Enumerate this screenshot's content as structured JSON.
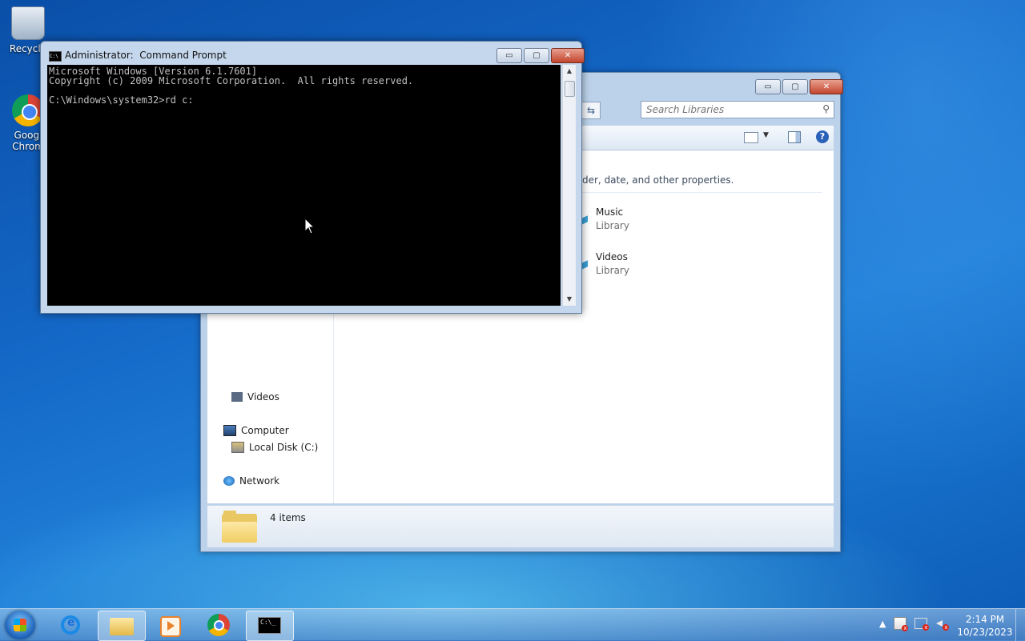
{
  "desktop": {
    "icons": [
      {
        "label": "Recycle",
        "icon": "recycle-bin-icon"
      },
      {
        "label": "Googl\nChrom",
        "icon": "chrome-icon"
      }
    ]
  },
  "explorer": {
    "search_placeholder": "Search Libraries",
    "description": "der, date, and other properties.",
    "nav": {
      "videos": "Videos",
      "computer": "Computer",
      "local_disk": "Local Disk (C:)",
      "network": "Network"
    },
    "libraries": [
      {
        "name": "Music",
        "type": "Library"
      },
      {
        "name": "Videos",
        "type": "Library"
      }
    ],
    "status": "4 items",
    "buttons": {
      "minimize": "▭",
      "maximize": "▢",
      "close": "✕"
    }
  },
  "cmd": {
    "title": "Administrator:  Command Prompt",
    "icon_text": "C:\\",
    "output": "Microsoft Windows [Version 6.1.7601]\nCopyright (c) 2009 Microsoft Corporation.  All rights reserved.\n\nC:\\Windows\\system32>rd c:",
    "buttons": {
      "minimize": "▭",
      "maximize": "▢",
      "close": "✕"
    }
  },
  "taskbar": {
    "cmd_icon_text": "C:\\_",
    "tray_arrow": "▲",
    "time": "2:14 PM",
    "date": "10/23/2023"
  },
  "colors": {
    "desktop_bg": "#1467c6",
    "console_bg": "#000000",
    "console_text": "#c0c0c0",
    "close_red": "#c2452d"
  }
}
